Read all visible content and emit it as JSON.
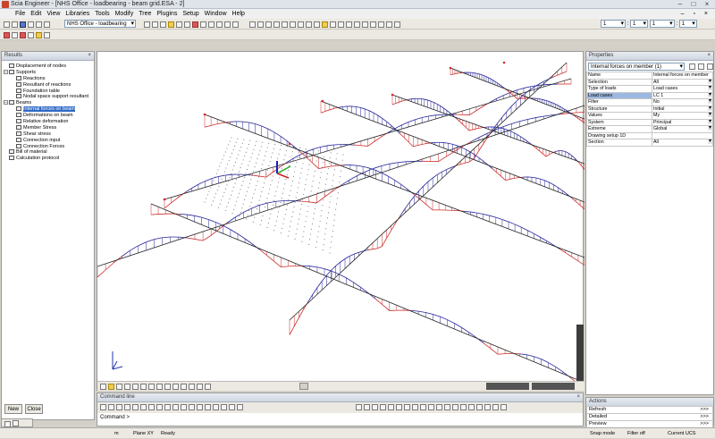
{
  "window": {
    "title": "Scia Engineer - [NHS Office - loadbearing - beam grid.ESA - 2]",
    "min_glyph": "–",
    "max_glyph": "□",
    "close_glyph": "×"
  },
  "menu": [
    "File",
    "Edit",
    "View",
    "Libraries",
    "Tools",
    "Modify",
    "Tree",
    "Plugins",
    "Setup",
    "Window",
    "Help"
  ],
  "mdi_controls": "– ▫ ×",
  "toolbar": {
    "project_combo": "NHS Office - loadbearing",
    "spin1": {
      "value": "1",
      "sep": ":",
      "value2": "1"
    },
    "spin2": {
      "value": "1",
      "sep": ":",
      "value2": "1"
    }
  },
  "results_panel": {
    "title": "Results",
    "close_glyph": "× ",
    "items": [
      {
        "label": "Displacement of nodes",
        "level": 0,
        "icon": "displacement-nodes-icon"
      },
      {
        "label": "Supports",
        "level": 0,
        "toggle": "−",
        "icon": "supports-icon"
      },
      {
        "label": "Reactions",
        "level": 1,
        "icon": "reactions-icon"
      },
      {
        "label": "Resultant of reactions",
        "level": 1,
        "icon": "resultant-icon"
      },
      {
        "label": "Foundation table",
        "level": 1,
        "icon": "foundation-table-icon"
      },
      {
        "label": "Nodal space support resultant",
        "level": 1,
        "icon": "nodal-support-icon"
      },
      {
        "label": "Beams",
        "level": 0,
        "toggle": "−",
        "icon": "beams-icon"
      },
      {
        "label": "Internal forces on beam",
        "level": 1,
        "icon": "internal-forces-icon",
        "selected": true
      },
      {
        "label": "Deformations on beam",
        "level": 1,
        "icon": "deformations-icon"
      },
      {
        "label": "Relative deformation",
        "level": 1,
        "icon": "relative-deformation-icon"
      },
      {
        "label": "Member Stress",
        "level": 1,
        "icon": "member-stress-icon"
      },
      {
        "label": "Shear stress",
        "level": 1,
        "icon": "shear-stress-icon"
      },
      {
        "label": "Connection input",
        "level": 1,
        "icon": "connection-input-icon"
      },
      {
        "label": "Connection Forces",
        "level": 1,
        "icon": "connection-forces-icon"
      },
      {
        "label": "Bill of material",
        "level": 0,
        "icon": "bill-material-icon"
      },
      {
        "label": "Calculation protocol",
        "level": 0,
        "icon": "calc-protocol-icon"
      }
    ],
    "new_button": "New",
    "close_button": "Close"
  },
  "properties_panel": {
    "title": "Properties",
    "close_glyph": "× ",
    "selector": "Internal forces on member (1)",
    "rows": [
      {
        "key": "Name",
        "value": "Internal forces on member",
        "combo": false
      },
      {
        "key": "Selection",
        "value": "All",
        "combo": true
      },
      {
        "key": "Type of loads",
        "value": "Load cases",
        "combo": true
      },
      {
        "key": "Load cases",
        "value": "LC 1",
        "combo": true,
        "highlight": true
      },
      {
        "key": "Filter",
        "value": "No",
        "combo": true
      },
      {
        "key": "Structure",
        "value": "Initial",
        "combo": true
      },
      {
        "key": "Values",
        "value": "My",
        "combo": true
      },
      {
        "key": "System",
        "value": "Principal",
        "combo": true
      },
      {
        "key": "Extreme",
        "value": "Global",
        "combo": true
      },
      {
        "key": "Drawing setup 1D",
        "value": "",
        "combo": false
      },
      {
        "key": "Section",
        "value": "All",
        "combo": true
      }
    ]
  },
  "actions_panel": {
    "title": "Actions",
    "items": [
      {
        "label": "Refresh",
        "arrow": ">>>"
      },
      {
        "label": "Detailed",
        "arrow": ">>>"
      },
      {
        "label": "Preview",
        "arrow": ">>>"
      }
    ]
  },
  "command_line": {
    "title": "Command line",
    "prompt": "Command >"
  },
  "statusbar": {
    "unit": "m",
    "plane": "Plane XY",
    "status": "Ready",
    "snap": "Snap mode",
    "filter": "Filter off",
    "ucs": "Current UCS"
  },
  "colors": {
    "positive": "#cc2b2b",
    "negative": "#24249a",
    "selection": "#316ac5"
  }
}
